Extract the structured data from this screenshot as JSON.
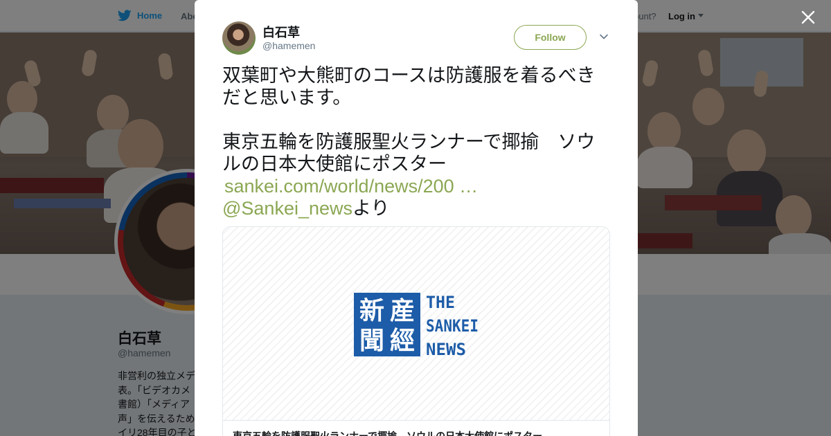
{
  "background": {
    "nav": {
      "home_label": "Home",
      "about_label": "Abo",
      "account_prompt": "ccount?",
      "login_label": "Log in"
    },
    "profile": {
      "name": "白石草",
      "handle": "@hamemen",
      "bio_lines": [
        "非営利の独立メデ",
        "表。「ビデオカメ",
        "書館）「メディア",
        "声」を伝えるため",
        "イリ28年目の子と"
      ]
    }
  },
  "modal": {
    "author": {
      "name": "白石草",
      "handle": "@hamemen"
    },
    "follow_label": "Follow",
    "tweet": {
      "line1": "双葉町や大熊町のコースは防護服を着るべき",
      "line2": "だと思います。",
      "line3": "東京五輪を防護服聖火ランナーで揶揄　ソウ",
      "line4": "ルの日本大使館にポスター",
      "link_url": "sankei.com/world/news/200 …",
      "mention": "@Sankei_news",
      "mention_suffix": "より"
    },
    "card": {
      "logo_kanji": [
        "産",
        "經",
        "新",
        "聞"
      ],
      "logo_words": [
        "THE",
        "SANKEI",
        "NEWS"
      ],
      "title": "東京五輪を防護服聖火ランナーで揶揄　ソウルの日本大使館にポスター"
    }
  },
  "colors": {
    "accent": "#8ba753",
    "twitter_blue": "#1da1f2",
    "sankei_blue": "#1d5ca8"
  },
  "icons": {
    "nav_home": "twitter-bird-icon",
    "close": "close-icon",
    "caret": "chevron-down-icon"
  }
}
